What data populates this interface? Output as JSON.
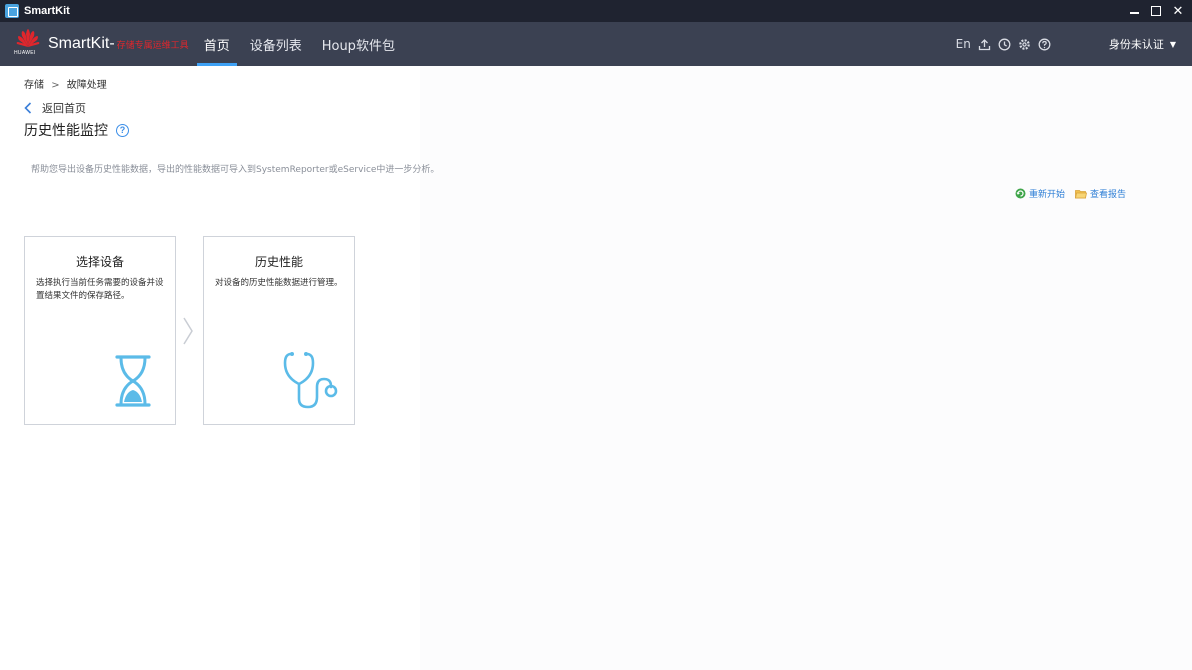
{
  "window": {
    "title": "SmartKit"
  },
  "header": {
    "logo_text": "HUAWEI",
    "brand": "SmartKit-",
    "brand_sub": "存储专属运维工具",
    "nav": [
      {
        "label": "首页",
        "active": true
      },
      {
        "label": "设备列表",
        "active": false
      },
      {
        "label": "Houp软件包",
        "active": false
      }
    ],
    "tools": {
      "lang": "En",
      "icons": [
        "upload-icon",
        "clock-icon",
        "gear-icon",
        "help-icon"
      ]
    },
    "user": "身份未认证"
  },
  "breadcrumb": {
    "root": "存储",
    "separator": ">",
    "current": "故障处理"
  },
  "back_label": "返回首页",
  "page_title": "历史性能监控",
  "description": "帮助您导出设备历史性能数据，导出的性能数据可导入到SystemReporter或eService中进一步分析。",
  "actions": {
    "restart": "重新开始",
    "view_report": "查看报告"
  },
  "steps": [
    {
      "title": "选择设备",
      "desc": "选择执行当前任务需要的设备并设置结果文件的保存路径。",
      "icon": "hourglass-icon"
    },
    {
      "title": "历史性能",
      "desc": "对设备的历史性能数据进行管理。",
      "icon": "stethoscope-icon"
    }
  ],
  "colors": {
    "appbar": "#3b4152",
    "titlebar": "#1f2330",
    "accent": "#3ea1f5",
    "icon_blue": "#5bbbe8"
  }
}
